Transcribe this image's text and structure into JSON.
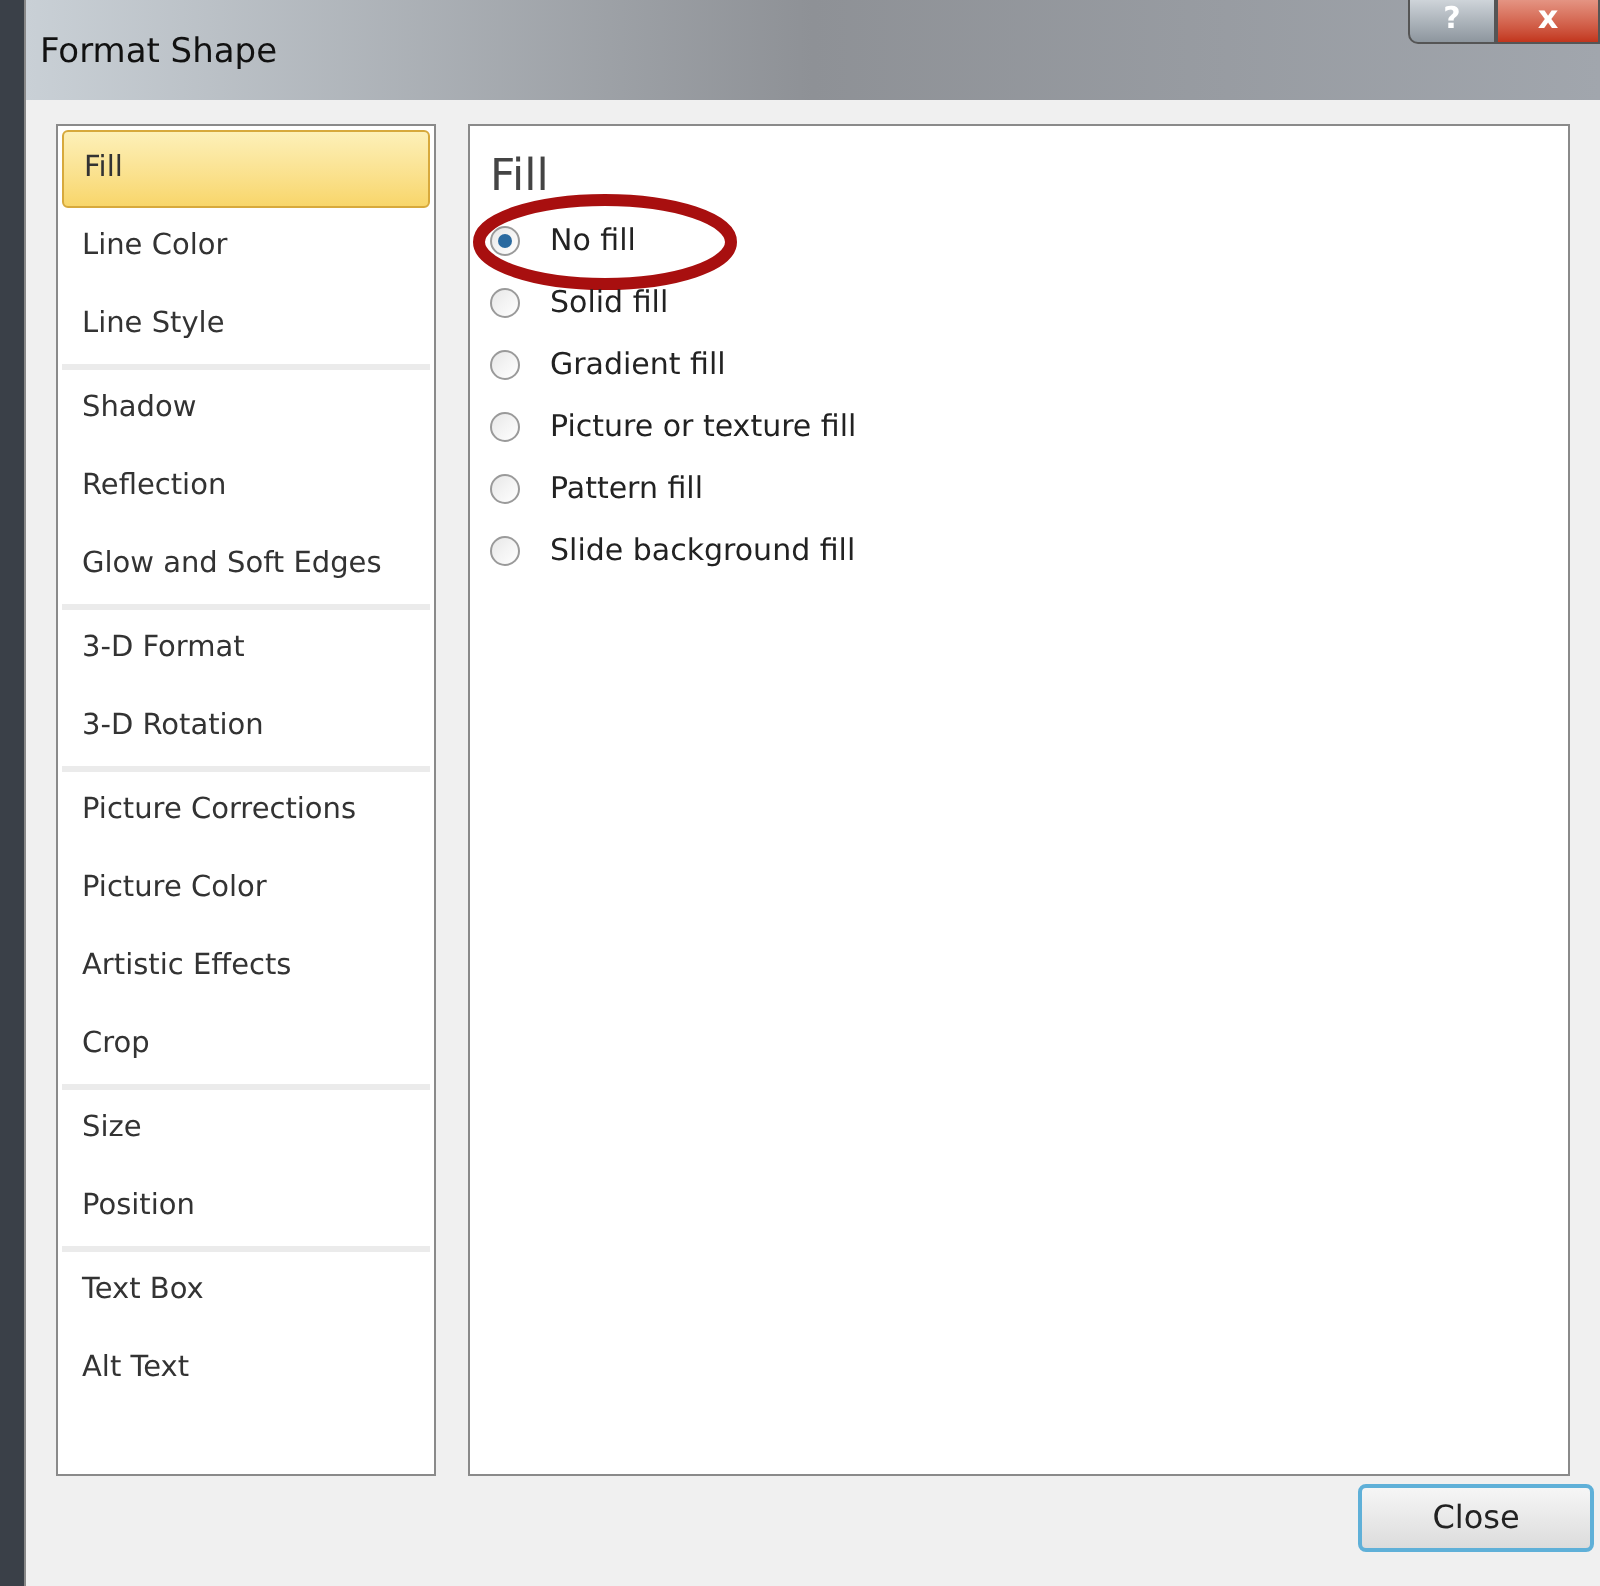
{
  "window": {
    "title": "Format Shape",
    "help_button": "?",
    "close_button": "x"
  },
  "sidebar": {
    "groups": [
      {
        "items": [
          {
            "label": "Fill",
            "selected": true
          },
          {
            "label": "Line Color",
            "selected": false
          },
          {
            "label": "Line Style",
            "selected": false
          }
        ]
      },
      {
        "items": [
          {
            "label": "Shadow",
            "selected": false
          },
          {
            "label": "Reflection",
            "selected": false
          },
          {
            "label": "Glow and Soft Edges",
            "selected": false
          }
        ]
      },
      {
        "items": [
          {
            "label": "3-D Format",
            "selected": false
          },
          {
            "label": "3-D Rotation",
            "selected": false
          }
        ]
      },
      {
        "items": [
          {
            "label": "Picture Corrections",
            "selected": false
          },
          {
            "label": "Picture Color",
            "selected": false
          },
          {
            "label": "Artistic Effects",
            "selected": false
          },
          {
            "label": "Crop",
            "selected": false
          }
        ]
      },
      {
        "items": [
          {
            "label": "Size",
            "selected": false
          },
          {
            "label": "Position",
            "selected": false
          }
        ]
      },
      {
        "items": [
          {
            "label": "Text Box",
            "selected": false
          },
          {
            "label": "Alt Text",
            "selected": false
          }
        ]
      }
    ]
  },
  "panel": {
    "heading": "Fill",
    "options": [
      {
        "label": "No fill",
        "selected": true,
        "circled": true
      },
      {
        "label": "Solid fill",
        "selected": false,
        "circled": false
      },
      {
        "label": "Gradient fill",
        "selected": false,
        "circled": false
      },
      {
        "label": "Picture or texture fill",
        "selected": false,
        "circled": false
      },
      {
        "label": "Pattern fill",
        "selected": false,
        "circled": false
      },
      {
        "label": "Slide background fill",
        "selected": false,
        "circled": false
      }
    ]
  },
  "buttons": [
    "Close"
  ]
}
